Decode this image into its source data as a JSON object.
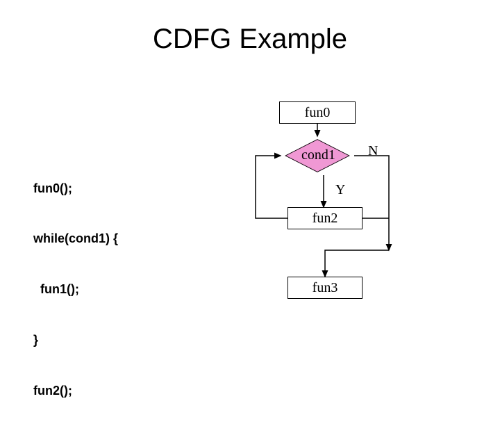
{
  "title": "CDFG Example",
  "code": {
    "line1": "fun0();",
    "line2": "while(cond1) {",
    "line3": "  fun1();",
    "line4": "}",
    "line5": "fun2();"
  },
  "nodes": {
    "fun0": "fun0",
    "cond1": "cond1",
    "fun2": "fun2",
    "fun3": "fun3"
  },
  "edge_labels": {
    "no": "N",
    "yes": "Y"
  },
  "colors": {
    "diamond_fill": "#f098d4"
  },
  "chart_data": {
    "type": "diagram",
    "title": "CDFG Example",
    "nodes": [
      {
        "id": "fun0",
        "label": "fun0",
        "shape": "rect"
      },
      {
        "id": "cond1",
        "label": "cond1",
        "shape": "diamond"
      },
      {
        "id": "fun2",
        "label": "fun2",
        "shape": "rect"
      },
      {
        "id": "fun3",
        "label": "fun3",
        "shape": "rect"
      }
    ],
    "edges": [
      {
        "from": "fun0",
        "to": "cond1",
        "label": ""
      },
      {
        "from": "cond1",
        "to": "fun2",
        "label": "Y"
      },
      {
        "from": "fun2",
        "to": "cond1",
        "label": ""
      },
      {
        "from": "cond1",
        "to": "fun3",
        "label": "N"
      }
    ]
  }
}
